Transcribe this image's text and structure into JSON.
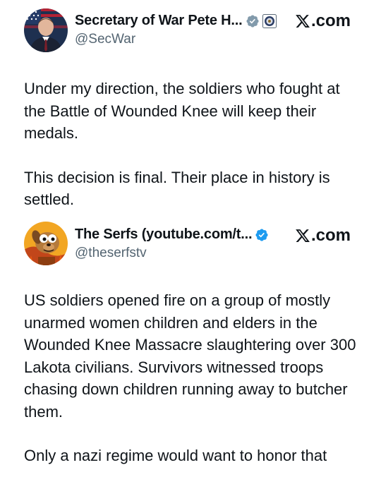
{
  "tweets": [
    {
      "author": {
        "display_name": "Secretary of War Pete H...",
        "handle": "@SecWar",
        "avatar_icon": "person-portrait-avatar",
        "verified_badge_color": "#829aab",
        "affiliation_icon": "department-seal-icon"
      },
      "source": {
        "label": ".com",
        "icon": "x-logo-icon"
      },
      "paragraphs": [
        "Under my direction, the soldiers who fought at the Battle of Wounded Knee will keep their medals.",
        "This decision is final. Their place in history is settled."
      ]
    },
    {
      "author": {
        "display_name": "The Serfs (youtube.com/t...",
        "handle": "@theserfstv",
        "avatar_icon": "cartoon-dog-avatar",
        "verified_badge_color": "#1d9bf0"
      },
      "source": {
        "label": ".com",
        "icon": "x-logo-icon"
      },
      "paragraphs": [
        "US soldiers opened fire on a group of mostly unarmed women children and elders in the Wounded Knee Massacre slaughtering over 300 Lakota civilians. Survivors witnessed troops chasing down children running away to butcher them.",
        "Only a nazi regime would want to honor that"
      ]
    }
  ]
}
